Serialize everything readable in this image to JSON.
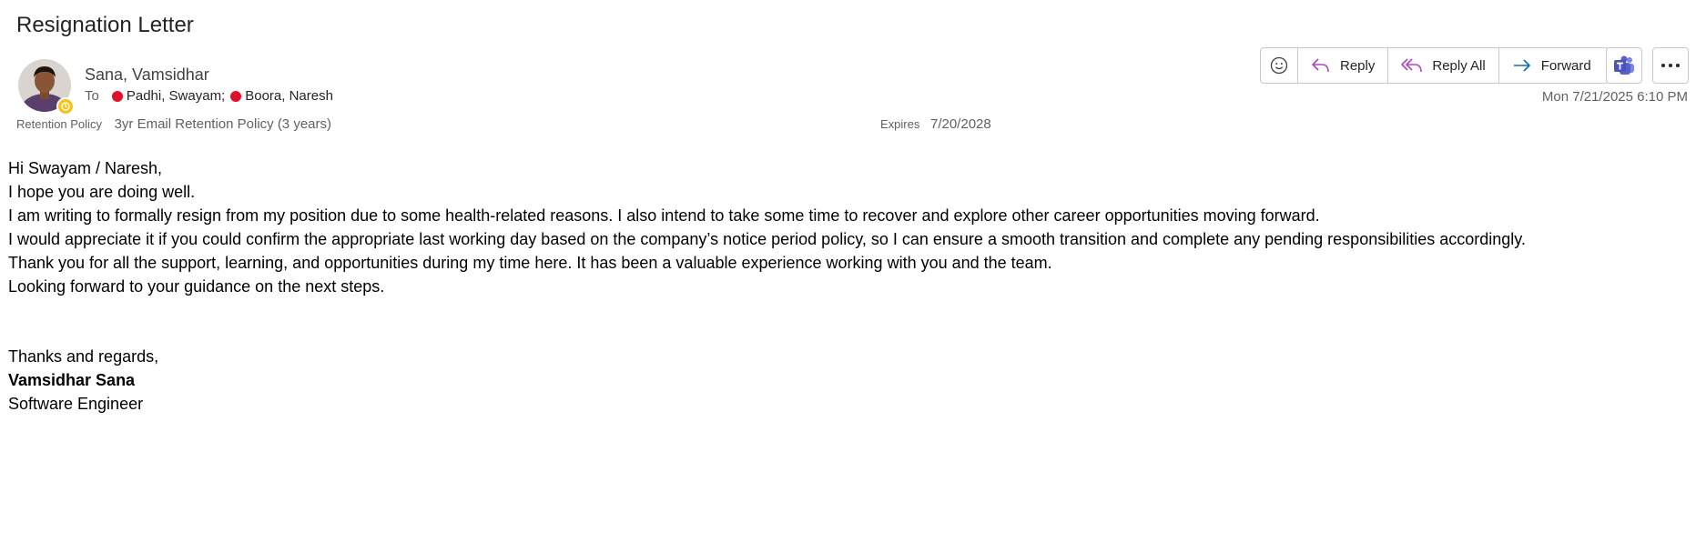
{
  "subject": "Resignation Letter",
  "sender": {
    "name": "Sana, Vamsidhar"
  },
  "recipients": {
    "label": "To",
    "items": [
      {
        "name": "Padhi, Swayam;",
        "status_color": "#e0102a"
      },
      {
        "name": "Boora, Naresh",
        "status_color": "#e0102a"
      }
    ]
  },
  "retention": {
    "label": "Retention Policy",
    "value": "3yr Email Retention Policy (3 years)",
    "expires_label": "Expires",
    "expires_value": "7/20/2028"
  },
  "toolbar": {
    "emoji_icon": "smiley-icon",
    "reply_label": "Reply",
    "reply_all_label": "Reply All",
    "forward_label": "Forward",
    "teams_icon": "teams-icon",
    "more_icon": "more-icon"
  },
  "datetime": "Mon 7/21/2025 6:10 PM",
  "body": {
    "greeting": "Hi Swayam / Naresh,",
    "lines": [
      "I hope you are doing well.",
      "I am writing to formally resign from my position due to some health-related reasons. I also intend to take some time to recover and explore other career opportunities moving forward.",
      "I would appreciate it if you could confirm the appropriate last working day based on the company’s notice period policy, so I can ensure a smooth transition and complete any pending responsibilities accordingly.",
      "Thank you for all the support, learning, and opportunities during my time here. It has been a valuable experience working with you and the team.",
      "Looking forward to your guidance on the next steps."
    ],
    "closing": "Thanks and regards,",
    "signature_name": "Vamsidhar Sana",
    "signature_title": "Software Engineer"
  },
  "colors": {
    "accent_reply": "#b146c2",
    "accent_forward": "#0f6cbd",
    "presence_away": "#f7c21b",
    "presence_busy": "#e0102a",
    "teams": "#5b5fc7"
  }
}
